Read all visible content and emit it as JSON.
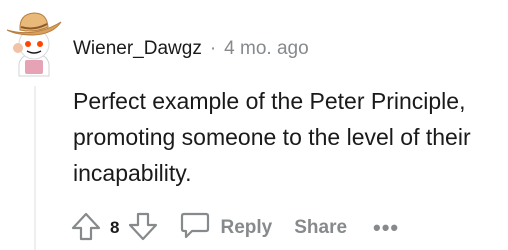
{
  "comment": {
    "username": "Wiener_Dawgz",
    "separator": "·",
    "timestamp": "4 mo. ago",
    "text": "Perfect example of the Peter Principle, promoting someone to the level of their incapability.",
    "avatar_icon": "snoo-cowboy-avatar"
  },
  "actions": {
    "upvote_icon": "upvote-arrow-icon",
    "vote_count": "8",
    "downvote_icon": "downvote-arrow-icon",
    "reply_icon": "speech-bubble-icon",
    "reply_label": "Reply",
    "share_label": "Share",
    "more_label": "•••"
  },
  "colors": {
    "text_primary": "#1a1a1b",
    "text_muted": "#878a8c",
    "thread_line": "#edeff1",
    "hat": "#e8b978",
    "avatar_eye": "#ff4500"
  }
}
